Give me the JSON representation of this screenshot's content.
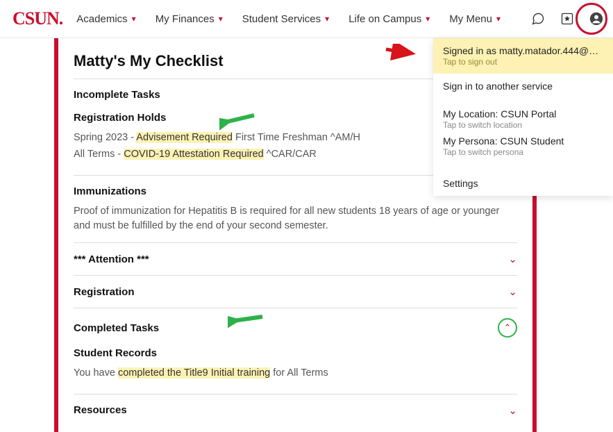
{
  "nav": {
    "logo": "CSUN",
    "items": [
      {
        "label": "Academics"
      },
      {
        "label": "My Finances"
      },
      {
        "label": "Student Services"
      },
      {
        "label": "Life on Campus"
      },
      {
        "label": "My Menu"
      }
    ]
  },
  "checklist": {
    "title": "Matty's My Checklist",
    "incomplete_heading": "Incomplete Tasks",
    "holds": {
      "heading": "Registration Holds",
      "line1_pre": "Spring 2023 - ",
      "line1_hl": "Advisement Required",
      "line1_post": " First Time Freshman ^AM/H",
      "line2_pre": "All Terms - ",
      "line2_hl": "COVID-19 Attestation Required",
      "line2_post": " ^CAR/CAR"
    },
    "immunizations": {
      "heading": "Immunizations",
      "body": "Proof of immunization for Hepatitis B is required for all new students 18 years of age or younger and must be fulfilled by the end of your second semester."
    },
    "attention_label": "*** Attention ***",
    "registration_label": "Registration",
    "completed_heading": "Completed Tasks",
    "records": {
      "heading": "Student Records",
      "line_pre": "You have ",
      "line_hl": "completed the Title9 Initial training",
      "line_post": " for All Terms"
    },
    "resources_label": "Resources"
  },
  "menu": {
    "signed_in_label": "Signed in as matty.matador.444@m…",
    "signed_in_hint": "Tap to sign out",
    "another_service": "Sign in to another service",
    "location_label": "My Location: CSUN Portal",
    "location_hint": "Tap to switch location",
    "persona_label": "My Persona: CSUN Student",
    "persona_hint": "Tap to switch persona",
    "settings": "Settings"
  }
}
